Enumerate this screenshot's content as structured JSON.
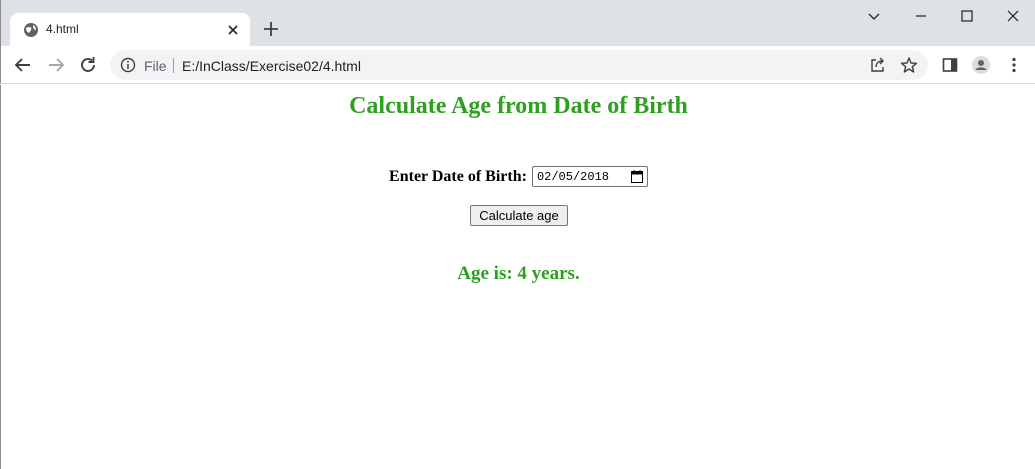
{
  "browser": {
    "tab": {
      "title": "4.html"
    },
    "address_bar": {
      "scheme_label": "File",
      "url": "E:/InClass/Exercise02/4.html"
    }
  },
  "page": {
    "title": "Calculate Age from Date of Birth",
    "form": {
      "dob_label": "Enter Date of Birth:",
      "dob_value": "02/05/2018",
      "calculate_button": "Calculate age"
    },
    "result": "Age is: 4 years."
  },
  "colors": {
    "heading_green": "#2ea01f",
    "tabstrip_bg": "#dee1e6",
    "omnibox_bg": "#f1f3f4"
  }
}
